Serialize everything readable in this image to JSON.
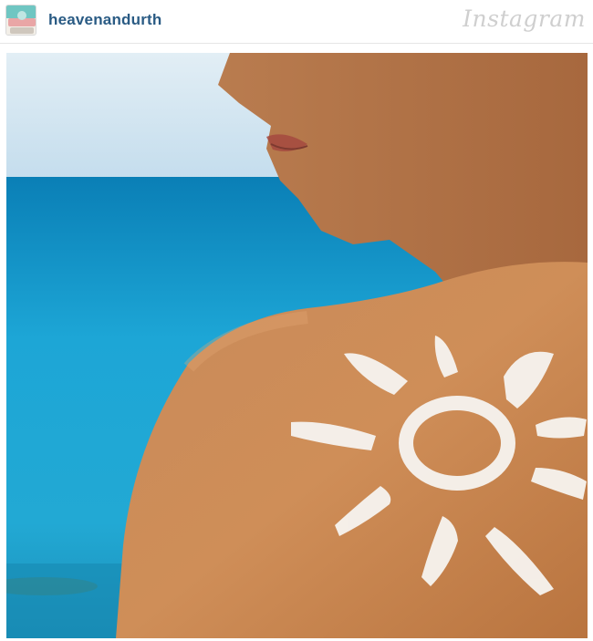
{
  "post": {
    "username": "heavenandurth",
    "brand": "Instagram"
  },
  "icons": {
    "avatar": "profile-avatar",
    "photo": "post-photo"
  },
  "colors": {
    "username": "#2a5b84",
    "brand": "#cfcfcf",
    "sea": "#1aa3d3",
    "sky": "#cfe6f3",
    "skin": "#c9854f",
    "sunscreen": "#f7f4f0"
  }
}
